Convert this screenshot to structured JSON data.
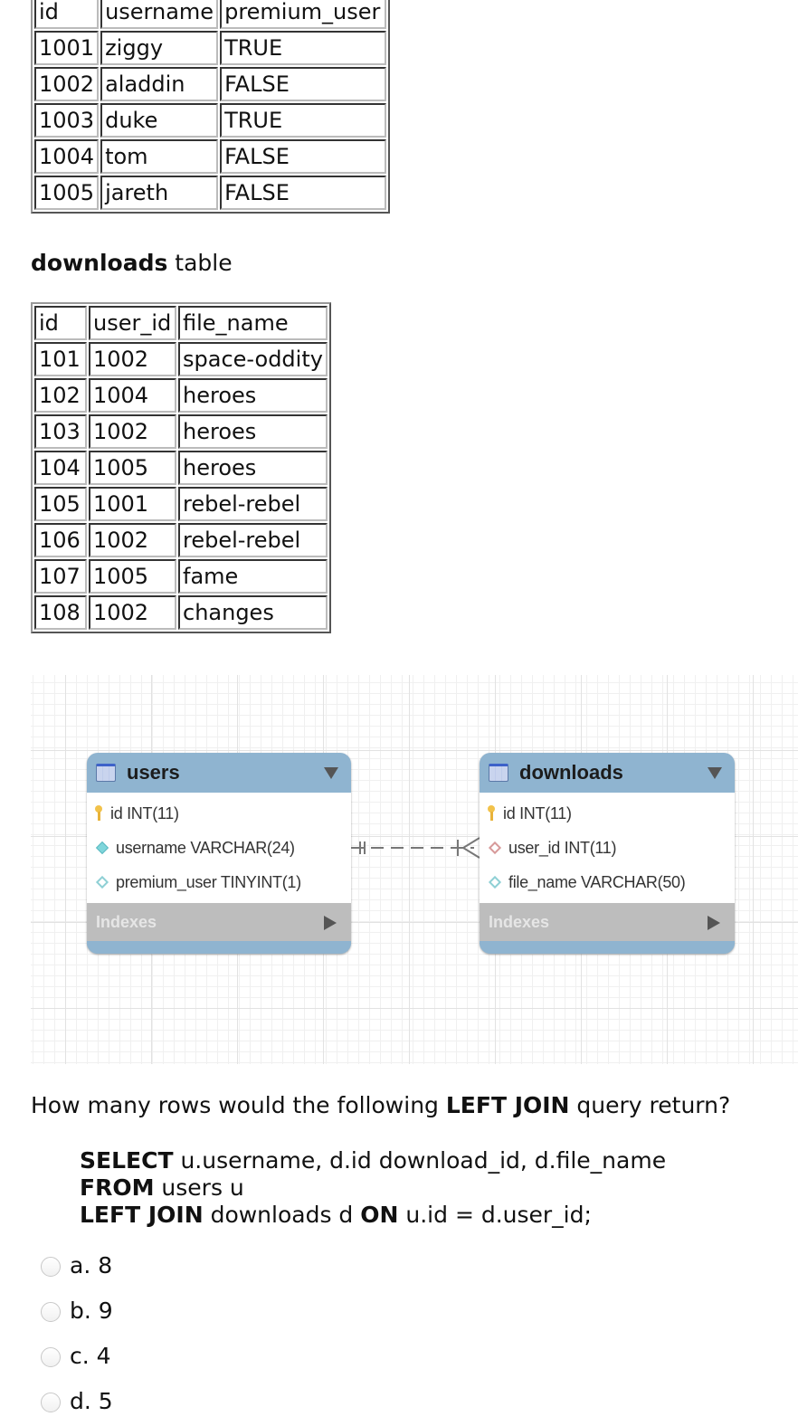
{
  "users_table": {
    "columns": [
      "id",
      "username",
      "premium_user"
    ],
    "rows": [
      [
        "1001",
        "ziggy",
        "TRUE"
      ],
      [
        "1002",
        "aladdin",
        "FALSE"
      ],
      [
        "1003",
        "duke",
        "TRUE"
      ],
      [
        "1004",
        "tom",
        "FALSE"
      ],
      [
        "1005",
        "jareth",
        "FALSE"
      ]
    ]
  },
  "downloads_heading": {
    "bold": "downloads",
    "rest": " table"
  },
  "downloads_table": {
    "columns": [
      "id",
      "user_id",
      "file_name"
    ],
    "rows": [
      [
        "101",
        "1002",
        "space-oddity"
      ],
      [
        "102",
        "1004",
        "heroes"
      ],
      [
        "103",
        "1002",
        "heroes"
      ],
      [
        "104",
        "1005",
        "heroes"
      ],
      [
        "105",
        "1001",
        "rebel-rebel"
      ],
      [
        "106",
        "1002",
        "rebel-rebel"
      ],
      [
        "107",
        "1005",
        "fame"
      ],
      [
        "108",
        "1002",
        "changes"
      ]
    ]
  },
  "er_diagram": {
    "header_color": "#8fb4d0",
    "entities": [
      {
        "name": "users",
        "columns": [
          {
            "icon": "primary-key-icon",
            "label": "id INT(11)"
          },
          {
            "icon": "filled-diamond-icon",
            "label": "username VARCHAR(24)"
          },
          {
            "icon": "hollow-diamond-icon",
            "label": "premium_user TINYINT(1)"
          }
        ],
        "indexes_label": "Indexes"
      },
      {
        "name": "downloads",
        "columns": [
          {
            "icon": "primary-key-icon",
            "label": "id INT(11)"
          },
          {
            "icon": "foreign-key-diamond-icon",
            "label": "user_id INT(11)"
          },
          {
            "icon": "hollow-diamond-icon",
            "label": "file_name VARCHAR(50)"
          }
        ],
        "indexes_label": "Indexes"
      }
    ],
    "relationship": {
      "from": "users",
      "to": "downloads",
      "type": "one-to-many (non-identifying)"
    }
  },
  "question": {
    "prefix": "How many rows would the following ",
    "bold": "LEFT JOIN",
    "suffix": " query return?"
  },
  "sql": {
    "line1_kw": "SELECT",
    "line1_rest": " u.username, d.id download_id, d.file_name",
    "line2_kw": "FROM",
    "line2_rest": " users u",
    "line3_kw1": "LEFT JOIN",
    "line3_mid": " downloads d ",
    "line3_kw2": "ON",
    "line3_rest": " u.id = d.user_id;"
  },
  "options": [
    {
      "letter": "a.",
      "value": "8"
    },
    {
      "letter": "b.",
      "value": "9"
    },
    {
      "letter": "c.",
      "value": "4"
    },
    {
      "letter": "d.",
      "value": "5"
    }
  ]
}
